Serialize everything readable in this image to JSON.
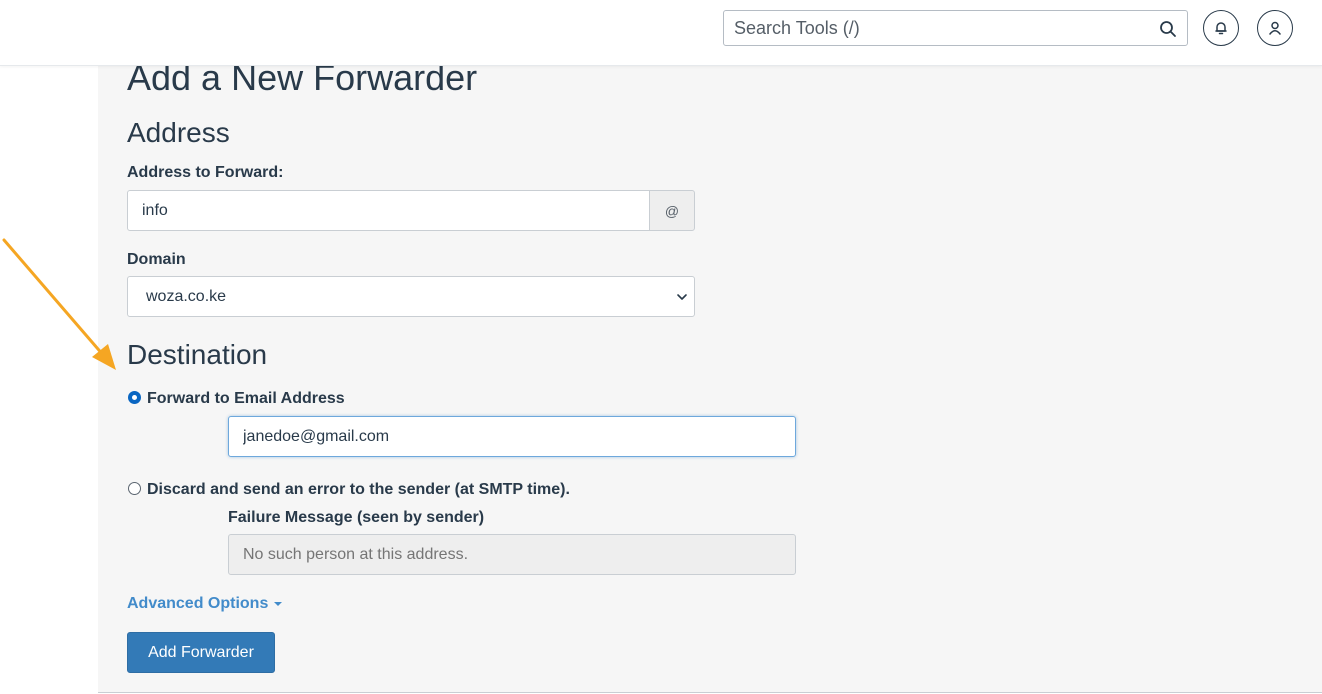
{
  "header": {
    "search_placeholder": "Search Tools (/)"
  },
  "page": {
    "title": "Add a New Forwarder"
  },
  "address_section": {
    "heading": "Address",
    "address_label": "Address to Forward:",
    "address_value": "info",
    "at_symbol": "@",
    "domain_label": "Domain",
    "domain_value": "woza.co.ke"
  },
  "destination_section": {
    "heading": "Destination",
    "forward_option_label": "Forward to Email Address",
    "forward_email_value": "janedoe@gmail.com",
    "discard_option_label": "Discard and send an error to the sender (at SMTP time).",
    "failure_label": "Failure Message (seen by sender)",
    "failure_placeholder": "No such person at this address.",
    "selected_option": "forward"
  },
  "advanced_options_label": "Advanced Options",
  "submit_label": "Add Forwarder",
  "colors": {
    "accent": "#337ab7",
    "link": "#428bca",
    "annotation_arrow": "#f5a623"
  },
  "icons": {
    "search": "search-icon",
    "bell": "bell-icon",
    "user": "user-icon",
    "dropdown": "chevron-down-icon",
    "caret": "caret-down-icon",
    "annotation": "arrow-icon"
  }
}
